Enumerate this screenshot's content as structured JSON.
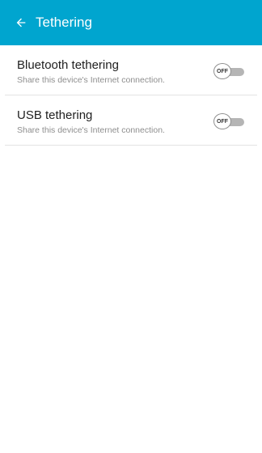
{
  "header": {
    "title": "Tethering",
    "back_icon": "back-arrow-icon",
    "color": "#00a5cf"
  },
  "items": [
    {
      "title": "Bluetooth tethering",
      "subtitle": "Share this device's Internet connection.",
      "toggle_state": "OFF"
    },
    {
      "title": "USB tethering",
      "subtitle": "Share this device's Internet connection.",
      "toggle_state": "OFF"
    }
  ]
}
